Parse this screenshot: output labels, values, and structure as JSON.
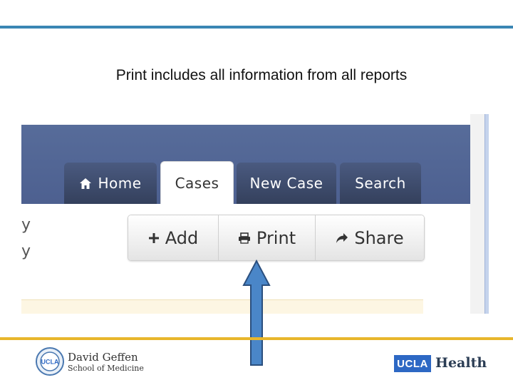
{
  "slide": {
    "title": "Print includes all information from all reports"
  },
  "navbar": {
    "tabs": [
      {
        "label": "Home",
        "icon": "home-icon"
      },
      {
        "label": "Cases",
        "active": true
      },
      {
        "label": "New Case"
      },
      {
        "label": "Search"
      }
    ]
  },
  "side_text": [
    "y",
    "y"
  ],
  "toolbar": {
    "add_label": "Add",
    "print_label": "Print",
    "share_label": "Share"
  },
  "colors": {
    "top_rule": "#3a86b4",
    "navbar": "#576c9a",
    "arrow": "#4a86c8",
    "bottom_rule": "#e8b62b",
    "ucla_blue": "#2d68c4"
  },
  "footer": {
    "seal_text": "UCLA",
    "school_line1": "David Geffen",
    "school_line2": "School of Medicine",
    "ucla": "UCLA",
    "health": "Health"
  }
}
